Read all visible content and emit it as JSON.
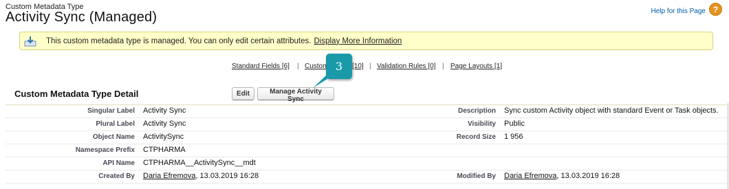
{
  "header": {
    "type_label": "Custom Metadata Type",
    "title": "Activity Sync (Managed)",
    "help_link": "Help for this Page",
    "help_icon": "help-icon"
  },
  "message": {
    "icon": "download-info-icon",
    "text": "This custom metadata type is managed. You can only edit certain attributes.",
    "link": "Display More Information"
  },
  "related_links": {
    "standard_fields": "Standard Fields [6]",
    "custom_fields_partial": "Custom",
    "custom_fields_count": "[10]",
    "validation_rules": "Validation Rules [0]",
    "page_layouts": "Page Layouts [1]",
    "separator": "|"
  },
  "callout": {
    "number": "3",
    "color": "#1a9aa8"
  },
  "detail": {
    "title": "Custom Metadata Type Detail",
    "edit_button": "Edit",
    "manage_button": "Manage Activity Sync",
    "left": [
      {
        "label": "Singular Label",
        "value": "Activity Sync"
      },
      {
        "label": "Plural Label",
        "value": "Activity Sync"
      },
      {
        "label": "Object Name",
        "value": "ActivitySync"
      },
      {
        "label": "Namespace Prefix",
        "value": "CTPHARMA"
      },
      {
        "label": "API Name",
        "value": "CTPHARMA__ActivitySync__mdt"
      },
      {
        "label": "Created By",
        "user": "Daria Efremova",
        "date": ", 13.03.2019 16:28"
      }
    ],
    "right": [
      {
        "label": "Description",
        "value": "Sync custom Activity object with standard Event or Task objects."
      },
      {
        "label": "Visibility",
        "value": "Public"
      },
      {
        "label": "Record Size",
        "value": "1 956"
      },
      {
        "label": "Modified By",
        "user": "Daria Efremova",
        "date": ", 13.03.2019 16:28"
      }
    ]
  }
}
